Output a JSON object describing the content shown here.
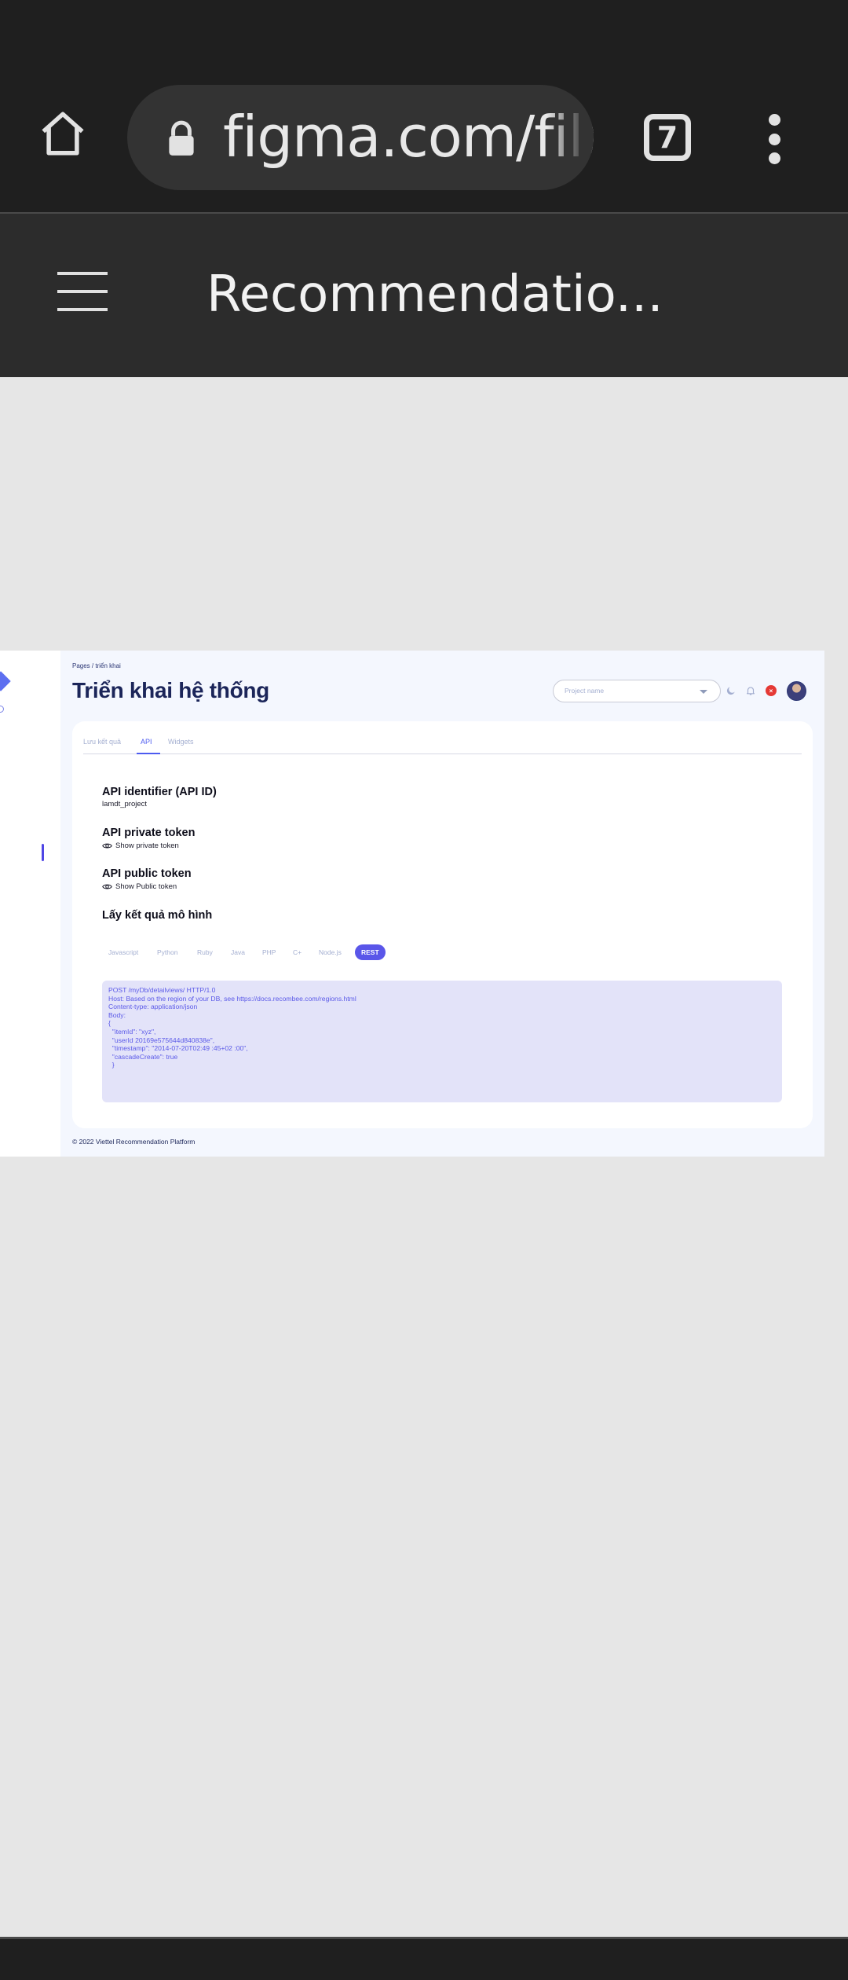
{
  "browser": {
    "url": "figma.com/file",
    "tab_count": "7",
    "file_title": "Recommendatio..."
  },
  "icons": [
    "home-icon",
    "lock-icon",
    "tabs-icon",
    "more-vert-icon",
    "hamburger-menu-icon",
    "moon-icon",
    "bell-icon",
    "eye-icon"
  ],
  "app": {
    "breadcrumb": "Pages / triển khai",
    "page_title": "Triển khai hệ thống",
    "project_select_placeholder": "Project name",
    "notification_badge": "×",
    "tabs": [
      "Lưu kết quả",
      "API",
      "Widgets"
    ],
    "active_tab": "API",
    "sections": {
      "api_id_title": "API identifier (API ID)",
      "api_id_value": "lamdt_project",
      "private_token_title": "API private token",
      "private_token_action": "Show private token",
      "public_token_title": "API public token",
      "public_token_action": "Show Public token",
      "results_title": "Lấy kết quả mô hình"
    },
    "languages": [
      "Javascript",
      "Python",
      "Ruby",
      "Java",
      "PHP",
      "C+",
      "Node.js",
      "REST"
    ],
    "active_language": "REST",
    "code_lines": [
      "POST /myDb/detailviews/ HTTP/1.0",
      "Host: Based on the region of your DB, see https://docs.recombee.com/regions.html",
      "Content-type: application/json",
      "",
      "Body:",
      "",
      "{",
      "  \"itemId\": \"xyz\",",
      "  \"userId 20169e575644d840838e\",",
      "  \"timestamp\": \"2014-07-20T02:49 :45+02 :00\",",
      "",
      "  \"cascadeCreate\": true",
      "  }"
    ],
    "footer": "© 2022 Viettel Recommendation Platform"
  },
  "colors": {
    "chrome_dark": "#1f1f1f",
    "toolbar": "#2c2c2c",
    "accent": "#4d5bf0",
    "code_bg": "#e3e3f9",
    "code_text": "#5b5ae8",
    "badge_red": "#e53935"
  }
}
